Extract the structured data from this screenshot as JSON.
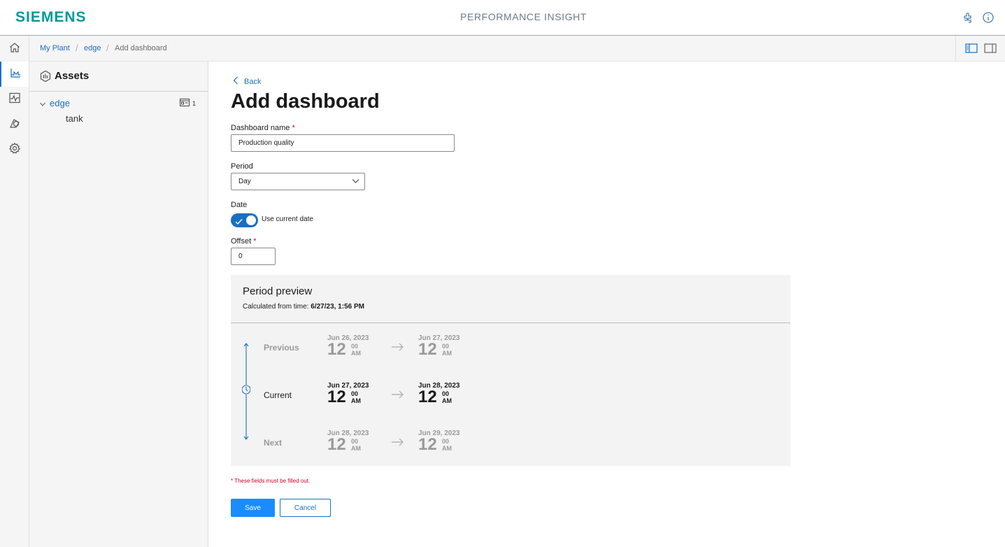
{
  "header": {
    "brand": "SIEMENS",
    "app_title": "PERFORMANCE INSIGHT",
    "icons": [
      "puzzle-icon",
      "info-icon"
    ],
    "brand_color": "#009999",
    "accent_color": "#1a6fc4"
  },
  "rail": {
    "items": [
      {
        "name": "home",
        "icon": "home-icon",
        "active": false
      },
      {
        "name": "assets",
        "icon": "asset-tree-icon",
        "active": true
      },
      {
        "name": "trend",
        "icon": "pulse-chart-icon",
        "active": false
      },
      {
        "name": "shapes",
        "icon": "shapes-icon",
        "active": false
      },
      {
        "name": "settings",
        "icon": "gear-icon",
        "active": false
      }
    ]
  },
  "breadcrumb": {
    "items": [
      "My Plant",
      "edge",
      "Add dashboard"
    ]
  },
  "sidebar": {
    "title": "Assets",
    "tree": {
      "root": "edge",
      "root_badge_count": "1",
      "children": [
        "tank"
      ]
    }
  },
  "form": {
    "back_label": "Back",
    "page_title": "Add dashboard",
    "dashboard_name": {
      "label": "Dashboard name",
      "required_mark": "*",
      "value": "Production quality"
    },
    "period": {
      "label": "Period",
      "value": "Day"
    },
    "date": {
      "label": "Date",
      "toggle_label": "Use current date",
      "toggle_on": true
    },
    "offset": {
      "label": "Offset",
      "required_mark": "*",
      "value": "0"
    },
    "required_note": "* These fields must be filled out.",
    "save_label": "Save",
    "cancel_label": "Cancel"
  },
  "preview": {
    "title": "Period preview",
    "calculated_label": "Calculated from time:",
    "calculated_value": "6/27/23, 1:56 PM",
    "rows": [
      {
        "label": "Previous",
        "start_date": "Jun 26, 2023",
        "start_hour": "12",
        "start_min": "00",
        "start_ampm": "AM",
        "end_date": "Jun 27, 2023",
        "end_hour": "12",
        "end_min": "00",
        "end_ampm": "AM"
      },
      {
        "label": "Current",
        "start_date": "Jun 27, 2023",
        "start_hour": "12",
        "start_min": "00",
        "start_ampm": "AM",
        "end_date": "Jun 28, 2023",
        "end_hour": "12",
        "end_min": "00",
        "end_ampm": "AM"
      },
      {
        "label": "Next",
        "start_date": "Jun 28, 2023",
        "start_hour": "12",
        "start_min": "00",
        "start_ampm": "AM",
        "end_date": "Jun 29, 2023",
        "end_hour": "12",
        "end_min": "00",
        "end_ampm": "AM"
      }
    ]
  }
}
